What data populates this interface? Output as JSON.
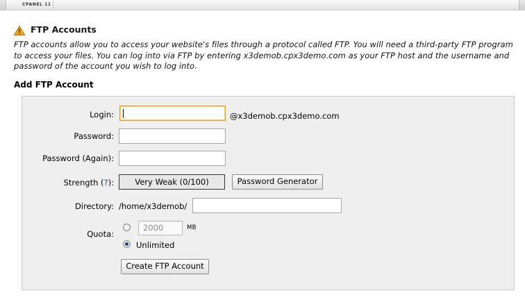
{
  "brand": "CPANEL 11",
  "page": {
    "title": "FTP Accounts",
    "description": "FTP accounts allow you to access your website's files through a protocol called FTP. You will need a third-party FTP program to access your files. You can log into via FTP by entering x3demob.cpx3demo.com as your FTP host and the username and password of the account you wish to log into."
  },
  "form": {
    "section_title": "Add FTP Account",
    "login_label": "Login:",
    "login_value": "",
    "domain_suffix": "@x3demob.cpx3demo.com",
    "password_label": "Password:",
    "password_again_label": "Password (Again):",
    "strength_label": "Strength (",
    "strength_help": "?",
    "strength_label_end": "):",
    "strength_value": "Very Weak (0/100)",
    "password_generator_button": "Password Generator",
    "directory_label": "Directory:",
    "directory_prefix": "/home/x3demob/",
    "directory_value": "",
    "quota_label": "Quota:",
    "quota_value": "2000",
    "quota_unit": "MB",
    "quota_unlimited_label": "Unlimited",
    "quota_selected": "Unlimited",
    "create_button": "Create FTP Account"
  },
  "colors": {
    "panel_bg": "#efefef",
    "focus_border": "#d8a020",
    "radio_selected": "#1f3c7a",
    "warning_icon": "#f0a818"
  },
  "icons": {
    "title_icon": "warning-triangle-icon"
  }
}
